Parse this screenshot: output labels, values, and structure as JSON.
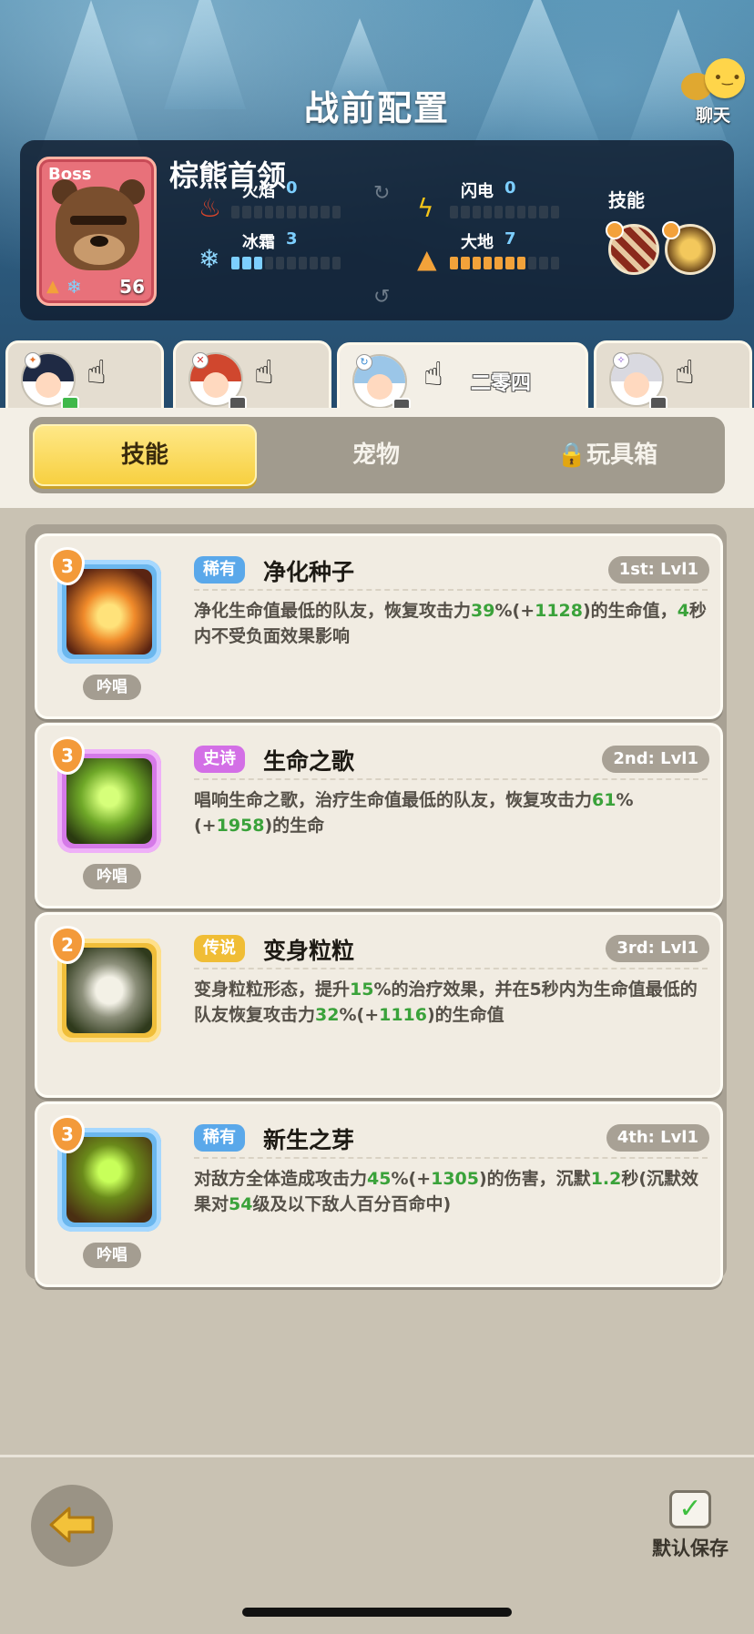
{
  "header": {
    "title": "战前配置",
    "chat_label": "聊天"
  },
  "boss": {
    "tag": "Boss",
    "name": "棕熊首领",
    "level": "56",
    "stats": [
      {
        "label": "火焰",
        "value": "0",
        "level": 0,
        "color": "#7dcfff",
        "icon": "flame-icon"
      },
      {
        "label": "闪电",
        "value": "0",
        "level": 0,
        "color": "#7dcfff",
        "icon": "lightning-icon"
      },
      {
        "label": "冰霜",
        "value": "3",
        "level": 3,
        "color": "#7dcfff",
        "icon": "snowflake-icon"
      },
      {
        "label": "大地",
        "value": "7",
        "level": 7,
        "color": "#f2a23a",
        "icon": "earth-icon"
      }
    ],
    "skills_label": "技能"
  },
  "heroes": [
    {
      "name": "",
      "active": false
    },
    {
      "name": "",
      "active": false
    },
    {
      "name": "二零四",
      "active": true
    },
    {
      "name": "",
      "active": false
    }
  ],
  "tabs": {
    "skill": "技能",
    "pet": "宠物",
    "toybox": "玩具箱"
  },
  "skills": [
    {
      "level": "3",
      "rarity": "稀有",
      "name": "净化种子",
      "slot": "1st: Lvl1",
      "chant": "吟唱",
      "desc": [
        "净化生命值最低的队友，恢复攻击力",
        "39",
        "%(+",
        "1128",
        ")的生命值，",
        "4",
        "秒内不受负面效果影响"
      ]
    },
    {
      "level": "3",
      "rarity": "史诗",
      "name": "生命之歌",
      "slot": "2nd: Lvl1",
      "chant": "吟唱",
      "desc": [
        "唱响生命之歌，治疗生命值最低的队友，恢复攻击力",
        "61",
        "%(+",
        "1958",
        ")的生命",
        "",
        ""
      ]
    },
    {
      "level": "2",
      "rarity": "传说",
      "name": "变身粒粒",
      "slot": "3rd: Lvl1",
      "chant": "",
      "desc": [
        "变身粒粒形态，提升",
        "15",
        "%的治疗效果，并在5秒内为生命值最低的队友恢复攻击力",
        "32",
        "%(+",
        "1116",
        ")的生命值"
      ]
    },
    {
      "level": "3",
      "rarity": "稀有",
      "name": "新生之芽",
      "slot": "4th: Lvl1",
      "chant": "吟唱",
      "desc": [
        "对敌方全体造成攻击力",
        "45",
        "%(+",
        "1305",
        ")的伤害，沉默",
        "1.2",
        "秒(沉默效果对",
        "54",
        "级及以下敌人百分百命中)"
      ]
    }
  ],
  "footer": {
    "save_label": "默认保存",
    "check": "✓"
  },
  "colors": {
    "accent_yellow": "#f7cf3e",
    "highlight_green": "#3aa23a",
    "rare": "#5aa8ea",
    "epic": "#d36fe6",
    "legend": "#f0bd35"
  }
}
